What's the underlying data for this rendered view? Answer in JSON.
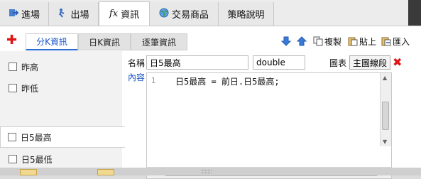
{
  "main_tabs": [
    {
      "label": "進場",
      "icon": "entry-icon"
    },
    {
      "label": "出場",
      "icon": "exit-icon"
    },
    {
      "label": "資訊",
      "prefix": "fx",
      "icon": "fx-icon",
      "active": true
    },
    {
      "label": "交易商品",
      "icon": "globe-icon"
    },
    {
      "label": "策略說明"
    }
  ],
  "sub_tabs": [
    {
      "label": "分K資訊",
      "active": true
    },
    {
      "label": "日K資訊"
    },
    {
      "label": "逐筆資訊"
    }
  ],
  "toolbar": {
    "add_icon": "plus-icon",
    "down_icon": "arrow-down-icon",
    "up_icon": "arrow-up-icon",
    "copy_label": "複製",
    "paste_label": "貼上",
    "import_label": "匯入"
  },
  "variables": [
    {
      "label": "昨高"
    },
    {
      "label": "昨低"
    },
    {
      "label": "日5最高",
      "selected": true
    },
    {
      "label": "日5最低"
    }
  ],
  "editor": {
    "name_label": "名稱",
    "name_value": "日5最高",
    "type_value": "double",
    "chart_label": "圖表",
    "chart_value": "主圖線段",
    "content_label": "內容",
    "line_number": "1",
    "code": "日5最高 = 前日.日5最高;"
  },
  "colors": {
    "accent_blue": "#1a55c8",
    "delete_red": "#e01414"
  }
}
